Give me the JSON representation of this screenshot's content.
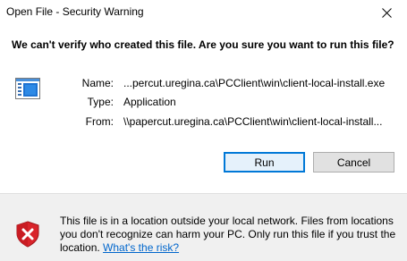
{
  "window": {
    "title": "Open File - Security Warning"
  },
  "question": "We can't verify who created this file. Are you sure you want to run this file?",
  "file_info": {
    "icon": "application-window-icon",
    "rows": [
      {
        "label": "Name:",
        "value": "...percut.uregina.ca\\PCClient\\win\\client-local-install.exe"
      },
      {
        "label": "Type:",
        "value": "Application"
      },
      {
        "label": "From:",
        "value": "\\\\papercut.uregina.ca\\PCClient\\win\\client-local-install..."
      }
    ]
  },
  "buttons": {
    "run": "Run",
    "cancel": "Cancel"
  },
  "warning": {
    "icon": "shield-x-icon",
    "text": "This file is in a location outside your local network. Files from locations you don't recognize can harm your PC. Only run this file if you trust the location.",
    "link": "What's the risk?"
  },
  "colors": {
    "footer_bg": "#f0f0f0",
    "link": "#0066cc",
    "shield_red": "#d9242b",
    "focus_blue": "#0078d7"
  }
}
